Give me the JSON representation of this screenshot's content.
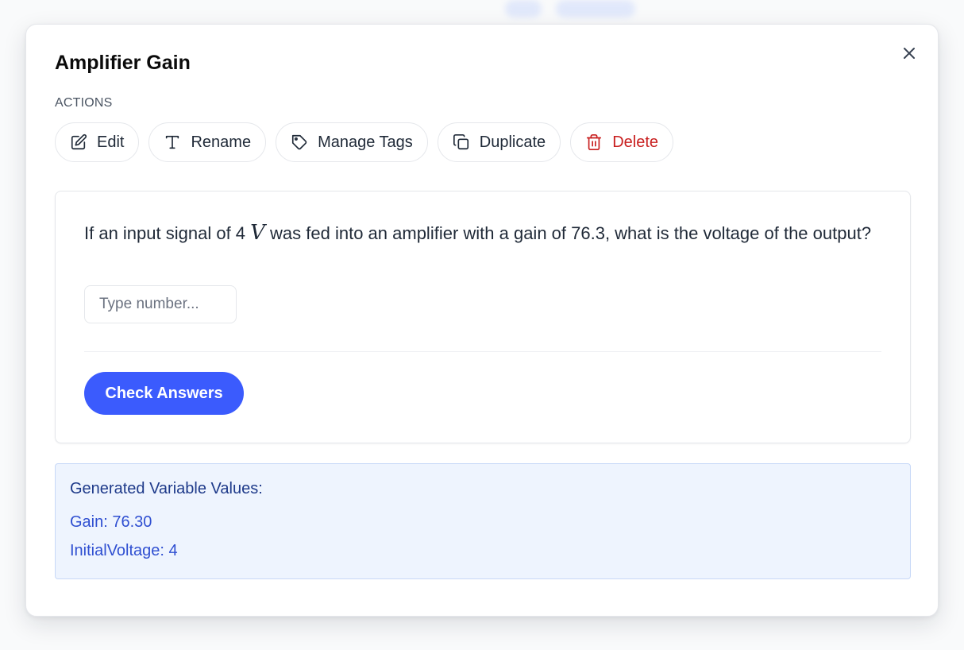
{
  "modal": {
    "title": "Amplifier Gain",
    "actions_label": "ACTIONS",
    "actions": [
      {
        "label": "Edit",
        "icon": "edit-icon"
      },
      {
        "label": "Rename",
        "icon": "text-icon"
      },
      {
        "label": "Manage Tags",
        "icon": "tag-icon"
      },
      {
        "label": "Duplicate",
        "icon": "copy-icon"
      },
      {
        "label": "Delete",
        "icon": "trash-icon"
      }
    ],
    "close_icon": "close-icon"
  },
  "question": {
    "text_before": "If an input signal of 4 ",
    "math_var": "V",
    "text_after": " was fed into an amplifier with a gain of 76.3, what is the voltage of the output?",
    "input_placeholder": "Type number...",
    "input_value": "",
    "check_label": "Check Answers"
  },
  "variables": {
    "title": "Generated Variable Values:",
    "items": [
      {
        "text": "Gain: 76.30"
      },
      {
        "text": "InitialVoltage: 4"
      }
    ]
  },
  "colors": {
    "primary": "#3b5bfd",
    "danger": "#c81e1e",
    "info_bg": "#eef4fe",
    "info_border": "#c7d8f7"
  }
}
